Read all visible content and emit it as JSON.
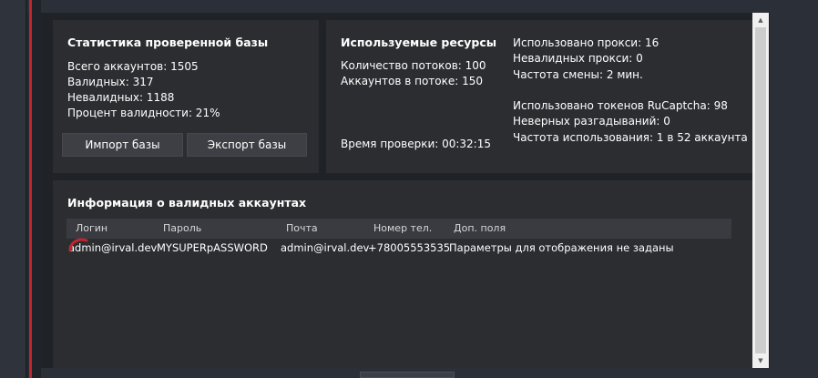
{
  "stats": {
    "title": "Статистика проверенной базы",
    "total": "Всего аккаунтов: 1505",
    "valid": "Валидных: 317",
    "invalid": "Невалидных: 1188",
    "percent": "Процент валидности: 21%",
    "import_label": "Импорт базы",
    "export_label": "Экспорт базы"
  },
  "resources": {
    "title": "Используемые ресурсы",
    "threads": "Количество потоков: 100",
    "per_thread": "Аккаунтов в потоке: 150",
    "check_time": "Время проверки: 00:32:15",
    "proxies_used": "Использовано прокси: 16",
    "proxies_invalid": "Невалидных прокси: 0",
    "change_rate": "Частота смены: 2 мин.",
    "tokens_used": "Использовано токенов RuCaptcha: 98",
    "wrong_solves": "Неверных разгадываний: 0",
    "usage_rate": "Частота использования: 1 в 52 аккаунта"
  },
  "valid_info": {
    "title": "Информация о валидных аккаунтах",
    "columns": [
      "Логин",
      "Пароль",
      "Почта",
      "Номер тел.",
      "Доп. поля"
    ],
    "rows": [
      [
        "admin@irval.dev",
        "MYSUPERpASSWORD",
        "admin@irval.dev",
        "+78005553535",
        "Параметры для отображения не заданы"
      ]
    ]
  },
  "colors": {
    "accent": "#c0262d",
    "panel": "#2c2d31",
    "background": "#1f2227"
  }
}
